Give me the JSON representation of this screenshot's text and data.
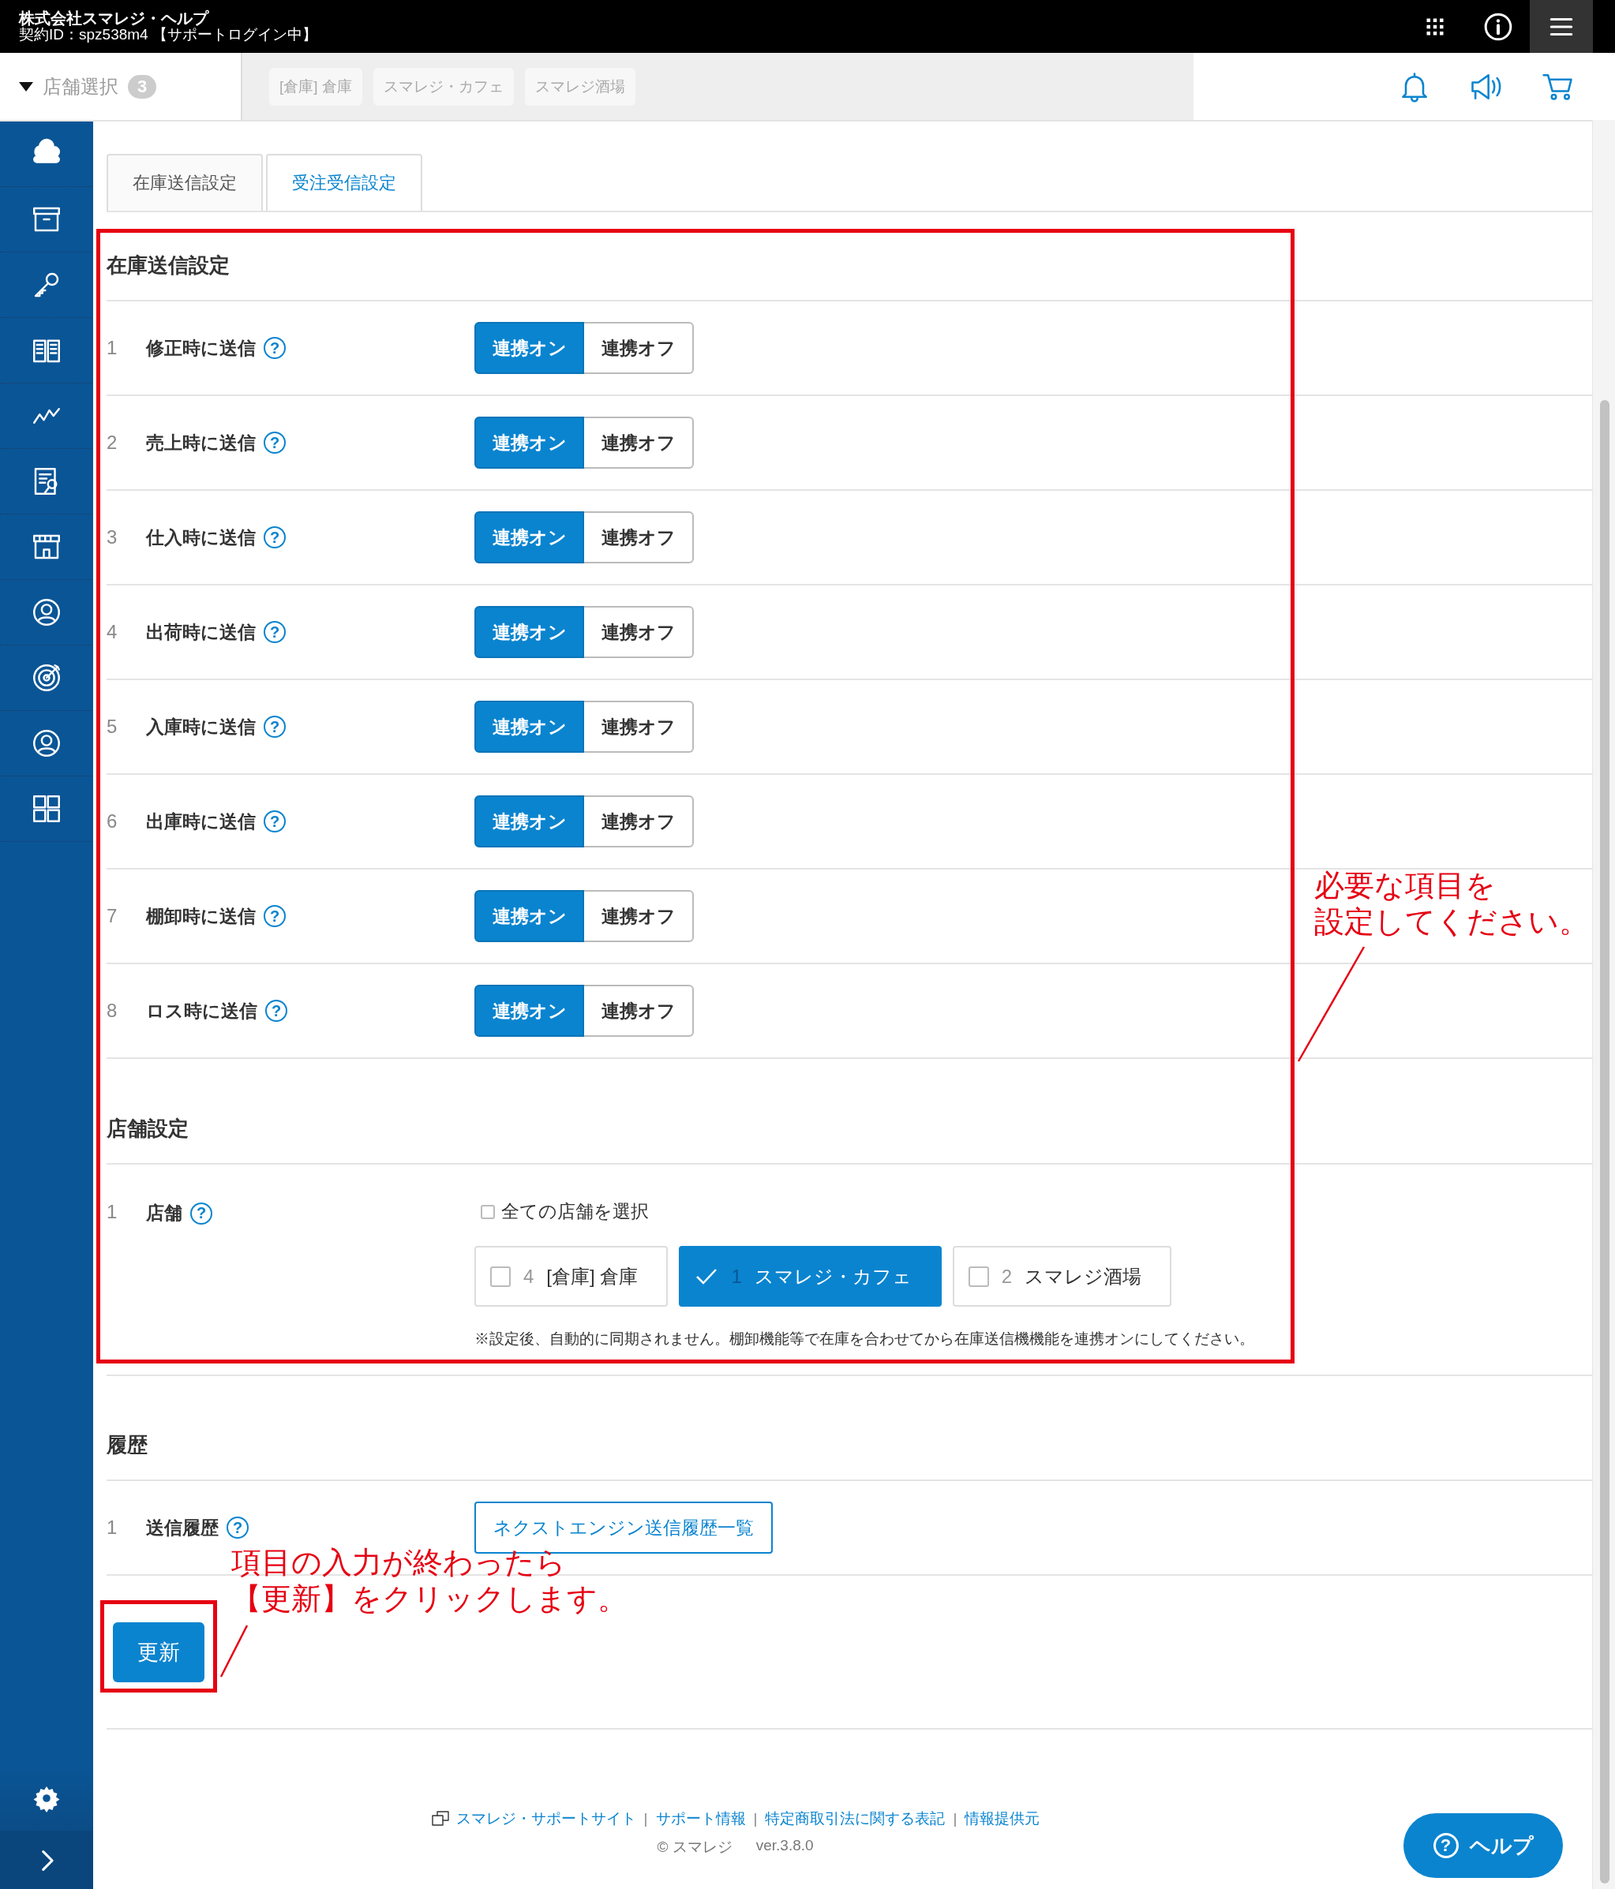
{
  "header": {
    "company": "株式会社スマレジ・ヘルプ",
    "contract": "契約ID：spz538m4 【サポートログイン中】"
  },
  "store_selector": {
    "label": "店舗選択",
    "count": "3"
  },
  "store_tags": [
    "[倉庫] 倉庫",
    "スマレジ・カフェ",
    "スマレジ酒場"
  ],
  "tabs": [
    {
      "label": "在庫送信設定",
      "selected": true
    },
    {
      "label": "受注受信設定",
      "selected": false
    }
  ],
  "sections": [
    {
      "title": "在庫送信設定",
      "rows": [
        {
          "kind": "toggle",
          "number": "1",
          "label": "修正時に送信",
          "help": "?",
          "options": [
            {
              "label": "連携オン",
              "selected": true
            },
            {
              "label": "連携オフ",
              "selected": false
            }
          ]
        },
        {
          "kind": "toggle",
          "number": "2",
          "label": "売上時に送信",
          "help": "?",
          "options": [
            {
              "label": "連携オン",
              "selected": true
            },
            {
              "label": "連携オフ",
              "selected": false
            }
          ]
        },
        {
          "kind": "toggle",
          "number": "3",
          "label": "仕入時に送信",
          "help": "?",
          "options": [
            {
              "label": "連携オン",
              "selected": true
            },
            {
              "label": "連携オフ",
              "selected": false
            }
          ]
        },
        {
          "kind": "toggle",
          "number": "4",
          "label": "出荷時に送信",
          "help": "?",
          "options": [
            {
              "label": "連携オン",
              "selected": true
            },
            {
              "label": "連携オフ",
              "selected": false
            }
          ]
        },
        {
          "kind": "toggle",
          "number": "5",
          "label": "入庫時に送信",
          "help": "?",
          "options": [
            {
              "label": "連携オン",
              "selected": true
            },
            {
              "label": "連携オフ",
              "selected": false
            }
          ]
        },
        {
          "kind": "toggle",
          "number": "6",
          "label": "出庫時に送信",
          "help": "?",
          "options": [
            {
              "label": "連携オン",
              "selected": true
            },
            {
              "label": "連携オフ",
              "selected": false
            }
          ]
        },
        {
          "kind": "toggle",
          "number": "7",
          "label": "棚卸時に送信",
          "help": "?",
          "options": [
            {
              "label": "連携オン",
              "selected": true
            },
            {
              "label": "連携オフ",
              "selected": false
            }
          ]
        },
        {
          "kind": "toggle",
          "number": "8",
          "label": "ロス時に送信",
          "help": "?",
          "options": [
            {
              "label": "連携オン",
              "selected": true
            },
            {
              "label": "連携オフ",
              "selected": false
            }
          ]
        }
      ]
    },
    {
      "title": "店舗設定",
      "rows": [
        {
          "kind": "stores",
          "number": "1",
          "label": "店舗",
          "help": "?",
          "select_all": {
            "label": "全ての店舗を選択",
            "checked": false
          },
          "stores": [
            {
              "number": "4",
              "name": "[倉庫] 倉庫",
              "checked": false
            },
            {
              "number": "1",
              "name": "スマレジ・カフェ",
              "checked": true
            },
            {
              "number": "2",
              "name": "スマレジ酒場",
              "checked": false
            }
          ],
          "note": "※設定後、自動的に同期されません。棚卸機能等で在庫を合わせてから在庫送信機機能を連携オンにしてください。"
        }
      ]
    },
    {
      "title": "履歴",
      "rows": [
        {
          "kind": "link_button",
          "number": "1",
          "label": "送信履歴",
          "help": "?",
          "button": "ネクストエンジン送信履歴一覧"
        }
      ]
    }
  ],
  "update_button": "更新",
  "footer": {
    "items": [
      {
        "kind": "link",
        "text": "スマレジ・サポートサイト"
      },
      {
        "kind": "sep",
        "text": "|"
      },
      {
        "kind": "link",
        "text": "サポート情報"
      },
      {
        "kind": "sep",
        "text": "|"
      },
      {
        "kind": "link",
        "text": "特定商取引法に関する表記"
      },
      {
        "kind": "sep",
        "text": "|"
      },
      {
        "kind": "link",
        "text": "情報提供元"
      }
    ],
    "copyright": "© スマレジ",
    "version": "ver.3.8.0"
  },
  "help_button": {
    "icon": "?",
    "label": "ヘルプ"
  },
  "annotations": [
    {
      "lines": [
        "必要な項目を",
        "設定してください。"
      ]
    },
    {
      "lines": [
        "項目の入力が終わったら",
        "【更新】をクリックします。"
      ]
    }
  ]
}
